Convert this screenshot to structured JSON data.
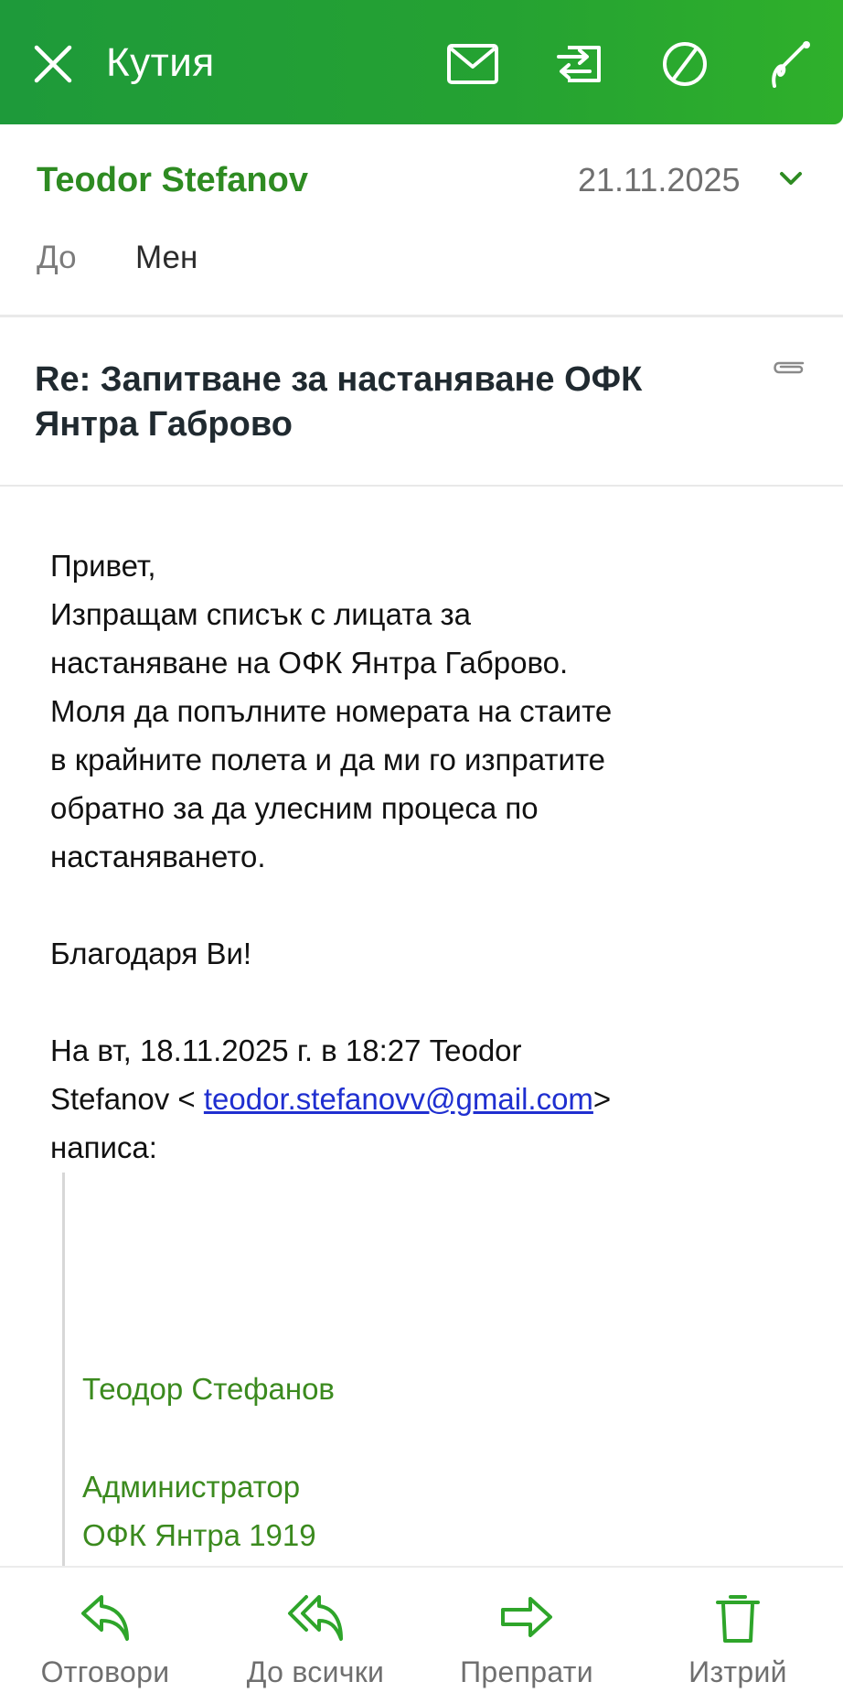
{
  "header": {
    "title": "Кутия",
    "icons": [
      "close-icon",
      "envelope-icon",
      "move-to-icon",
      "block-icon",
      "flag-icon"
    ]
  },
  "message": {
    "sender": "Teodor Stefanov",
    "date": "21.11.2025",
    "to_label": "До",
    "to_value": "Мен",
    "subject_line1": "Re: Запитване за настаняване ОФК",
    "subject_line2": "Янтра Габрово",
    "has_attachment": true
  },
  "body": {
    "lines": [
      "Привет,",
      "Изпращам списък с лицата за",
      "настаняване на ОФК Янтра Габрово.",
      "Моля да попълните номерата на стаите",
      "в крайните полета и да ми го изпратите",
      "обратно за да улесним процеса по",
      "настаняването."
    ],
    "thanks": "Благодаря Ви!",
    "quote_intro": "На вт, 18.11.2025 г. в 18:27 Teodor",
    "quote_name_prefix": "Stefanov < ",
    "quote_email": "teodor.stefanovv@gmail.com",
    "quote_name_suffix": ">",
    "quote_wrote": "написа:"
  },
  "signature": {
    "name": "Теодор Стефанов",
    "role": "Администратор",
    "org": "ОФК Янтра 1919"
  },
  "actions": {
    "reply": "Отговори",
    "reply_all": "До всички",
    "forward": "Препрати",
    "delete": "Изтрий"
  },
  "colors": {
    "brand_green": "#25a232",
    "sender_green": "#2e8b22",
    "signature_green": "#3b8a1e",
    "link_blue": "#1f2fd0"
  }
}
